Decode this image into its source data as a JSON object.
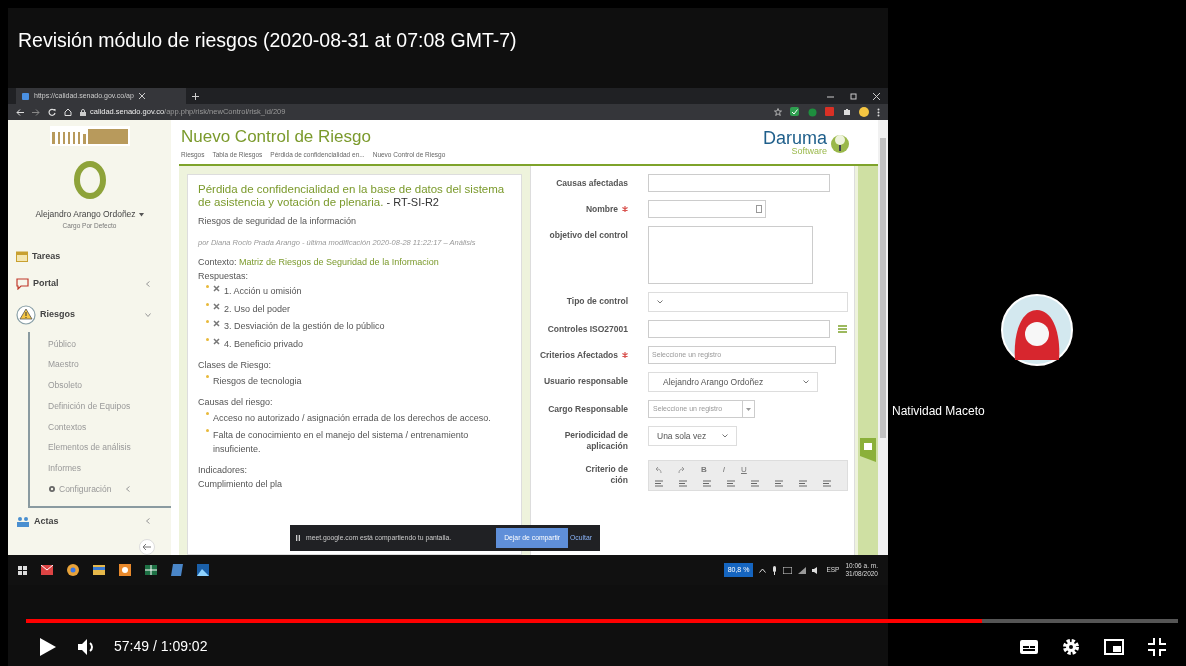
{
  "video": {
    "title": "Revisión módulo de riesgos (2020-08-31 at 07:08 GMT-7)",
    "level": 0.83,
    "time": "57:49 / 1:09:02"
  },
  "browser": {
    "tab_title": "https://calidad.senado.gov.co/ap",
    "url_domain": "calidad.senado.gov.co",
    "url_path": "/app.php/risk/newControl/risk_id/209"
  },
  "sidebar": {
    "user": "Alejandro Arango Ordoñez",
    "role": "Cargo Por Defecto",
    "items": [
      {
        "label": "Tareas",
        "kind": "calendar"
      },
      {
        "label": "Portal",
        "kind": "chat",
        "expanded": false
      },
      {
        "label": "Riesgos",
        "kind": "warning",
        "expanded": true,
        "children": [
          {
            "label": "Público"
          },
          {
            "label": "Maestro"
          },
          {
            "label": "Obsoleto"
          },
          {
            "label": "Definición de Equipos"
          },
          {
            "label": "Contextos"
          },
          {
            "label": "Elementos de análisis"
          },
          {
            "label": "Informes"
          },
          {
            "label": "Configuración",
            "kind": "gear",
            "expanded": false
          }
        ]
      },
      {
        "label": "Actas",
        "kind": "people",
        "expanded": false
      }
    ]
  },
  "page": {
    "title": "Nuevo Control de Riesgo",
    "breadcrumb": [
      "Riesgos",
      "Tabla de Riesgos",
      "Pérdida de confidencialidad en...",
      "Nuevo Control de Riesgo"
    ],
    "logo": {
      "name": "Daruma",
      "sub": "Software"
    }
  },
  "risk": {
    "title": "Pérdida de confidencialidad en la base de datos del sistema de asistencia y votación de plenaria.",
    "code": "- RT-SI-R2",
    "category": "Riesgos de seguridad de la información",
    "byline": "por Diana Rocio Prada Arango - última modificación 2020-08-28 11:22:17 – Análisis",
    "context_label": "Contexto:",
    "context": "Matriz de Riesgos de Seguridad de la Informacion",
    "sections": [
      {
        "title": "Respuestas:",
        "kind": "marked",
        "items": [
          "1. Acción u omisión",
          "2. Uso del poder",
          "3. Desviación de la gestión de lo público",
          "4. Beneficio privado"
        ]
      },
      {
        "title": "Clases de Riesgo:",
        "kind": "bullet",
        "items": [
          "Riesgos de tecnologia"
        ]
      },
      {
        "title": "Causas del riesgo:",
        "kind": "bullet",
        "items": [
          "Acceso no autorizado / asignación errada de los derechos de acceso.",
          "Falta de conocimiento en el manejo del sistema / entrenamiento insuficiente."
        ]
      },
      {
        "title": "Indicadores:",
        "kind": "plain",
        "items": [
          "Cumplimiento del pla"
        ]
      }
    ]
  },
  "form": {
    "fields": [
      {
        "label": "Causas afectadas",
        "required": false,
        "kind": "input"
      },
      {
        "label": "Nombre",
        "required": true,
        "kind": "input-addon"
      },
      {
        "label": "objetivo del control",
        "required": false,
        "kind": "textarea"
      },
      {
        "label": "Tipo de control",
        "required": false,
        "kind": "select"
      },
      {
        "label": "Controles ISO27001",
        "required": false,
        "kind": "list-input"
      },
      {
        "label": "Criterios Afectados",
        "required": true,
        "kind": "input",
        "placeholder": "Seleccione un registro"
      },
      {
        "label": "Usuario responsable",
        "required": false,
        "kind": "select",
        "value": "Alejandro Arango Ordoñez"
      },
      {
        "label": "Cargo Responsable",
        "required": false,
        "kind": "combo",
        "placeholder": "Seleccione un registro"
      },
      {
        "label": "Periodicidad de aplicación",
        "required": false,
        "kind": "select",
        "value": "Una sola vez"
      },
      {
        "label": "Criterio de",
        "label_end": "ción",
        "required": false,
        "kind": "editor",
        "format_buttons": [
          "B",
          "I",
          "U"
        ]
      }
    ]
  },
  "share_bar": {
    "text": "meet.google.com está compartiendo tu pantalla.",
    "stop": "Dejar de compartir",
    "hide": "Ocultar"
  },
  "taskbar": {
    "zoom": "80,8 %",
    "lang": "ESP",
    "time": "10:06 a. m.",
    "date": "31/08/2020"
  },
  "participant": {
    "name": "Natividad Maceto"
  }
}
